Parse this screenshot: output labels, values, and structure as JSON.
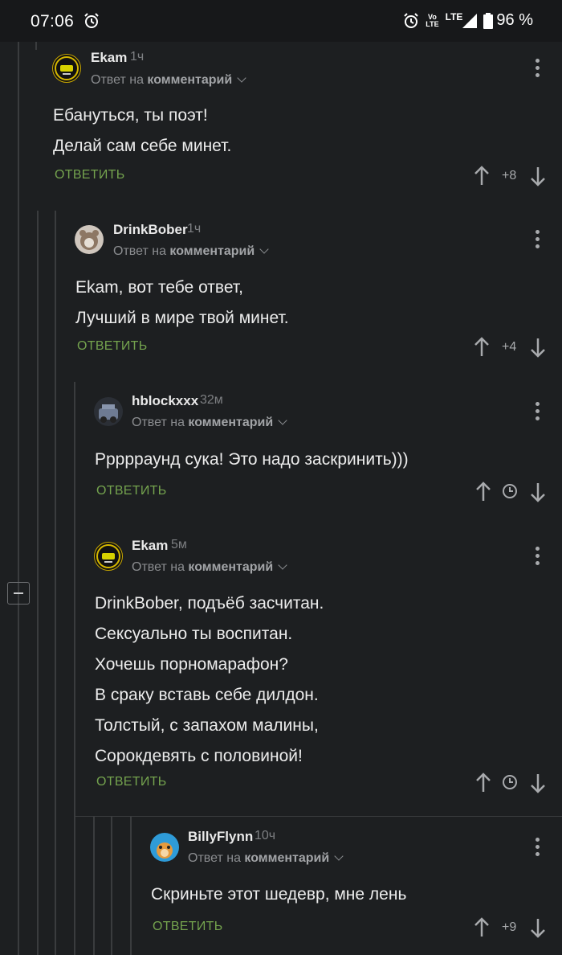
{
  "status_bar": {
    "time": "07:06",
    "battery": "96 %",
    "volte_label": "Vo\nLTE",
    "network": "LTE"
  },
  "reply_label": "Ответ на",
  "comment_label": "комментарий",
  "reply_button": "ОТВЕТИТЬ",
  "comments": [
    {
      "author": "Ekam",
      "time": "1ч",
      "lines": [
        "Ебануться, ты поэт!",
        "Делай сам себе минет."
      ],
      "score": "+8"
    },
    {
      "author": "DrinkBober",
      "time": "1ч",
      "lines": [
        "Ekam, вот тебе ответ,",
        "Лучший в мире твой минет."
      ],
      "score": "+4"
    },
    {
      "author": "hblockxxx",
      "time": "32м",
      "lines": [
        "Ррррраунд сука! Это надо заскринить)))"
      ],
      "score": ""
    },
    {
      "author": "Ekam",
      "time": "5м",
      "lines": [
        "DrinkBober, подъёб засчитан.",
        "Сексуально ты воспитан.",
        "Хочешь порномарафон?",
        "В сраку вставь себе дилдон.",
        "Толстый, с запахом малины,",
        "Сорокдевять с половиной!"
      ],
      "score": ""
    },
    {
      "author": "BillyFlynn",
      "time": "10ч",
      "lines": [
        "Скриньте этот шедевр, мне лень"
      ],
      "score": "+9"
    }
  ],
  "icons": {
    "up": "arrow-up-icon",
    "down": "arrow-down-icon",
    "clock": "clock-icon",
    "more": "more-vert-icon",
    "alarm": "alarm-icon"
  }
}
